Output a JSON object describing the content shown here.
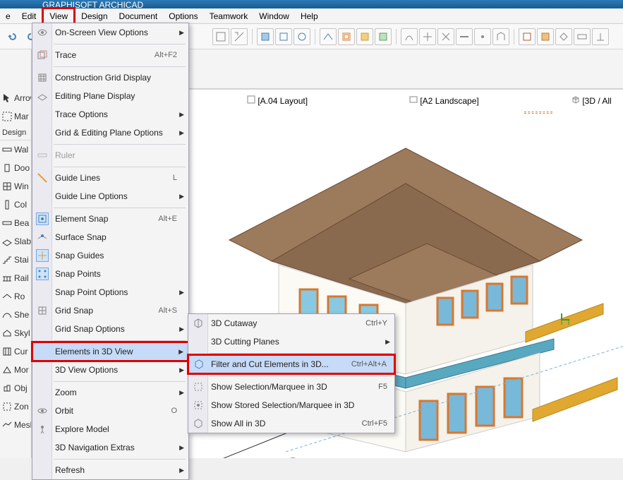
{
  "title_bar": "GRAPHISOFT ARCHICAD",
  "menu_bar": {
    "items": [
      "e",
      "Edit",
      "View",
      "Design",
      "Document",
      "Options",
      "Teamwork",
      "Window",
      "Help"
    ]
  },
  "tabs": {
    "layout": "[A.04 Layout]",
    "landscape": "[A2 Landscape]",
    "threed": "[3D / All"
  },
  "left_panel": {
    "arrow": "Arrow",
    "marquee": "Mar",
    "design_header": "Design",
    "tools": [
      "Wal",
      "Doo",
      "Win",
      "Col",
      "Bea",
      "Slab",
      "Stai",
      "Rail",
      "Ro",
      "She",
      "Skyl",
      "Cur",
      "Mor",
      "Obj",
      "Zon",
      "Mesh"
    ]
  },
  "view_menu": {
    "on_screen": "On-Screen View Options",
    "trace": "Trace",
    "trace_short": "Alt+F2",
    "grid_display": "Construction Grid Display",
    "plane_display": "Editing Plane Display",
    "trace_options": "Trace Options",
    "grid_plane_options": "Grid & Editing Plane Options",
    "ruler": "Ruler",
    "guide_lines": "Guide Lines",
    "guide_lines_short": "L",
    "guide_line_options": "Guide Line Options",
    "element_snap": "Element Snap",
    "element_snap_short": "Alt+E",
    "surface_snap": "Surface Snap",
    "snap_guides": "Snap Guides",
    "snap_points": "Snap Points",
    "snap_point_options": "Snap Point Options",
    "grid_snap": "Grid Snap",
    "grid_snap_short": "Alt+S",
    "grid_snap_options": "Grid Snap Options",
    "elements_3d": "Elements in 3D View",
    "view_3d_options": "3D View Options",
    "zoom": "Zoom",
    "orbit": "Orbit",
    "orbit_short": "O",
    "explore_model": "Explore Model",
    "nav_extras": "3D Navigation Extras",
    "refresh": "Refresh"
  },
  "submenu": {
    "cutaway": "3D Cutaway",
    "cutaway_short": "Ctrl+Y",
    "cutting_planes": "3D Cutting Planes",
    "filter_cut": "Filter and Cut Elements in 3D...",
    "filter_cut_short": "Ctrl+Alt+A",
    "show_sel": "Show Selection/Marquee in 3D",
    "show_sel_short": "F5",
    "show_stored": "Show Stored Selection/Marquee in 3D",
    "show_all": "Show All in 3D",
    "show_all_short": "Ctrl+F5"
  }
}
